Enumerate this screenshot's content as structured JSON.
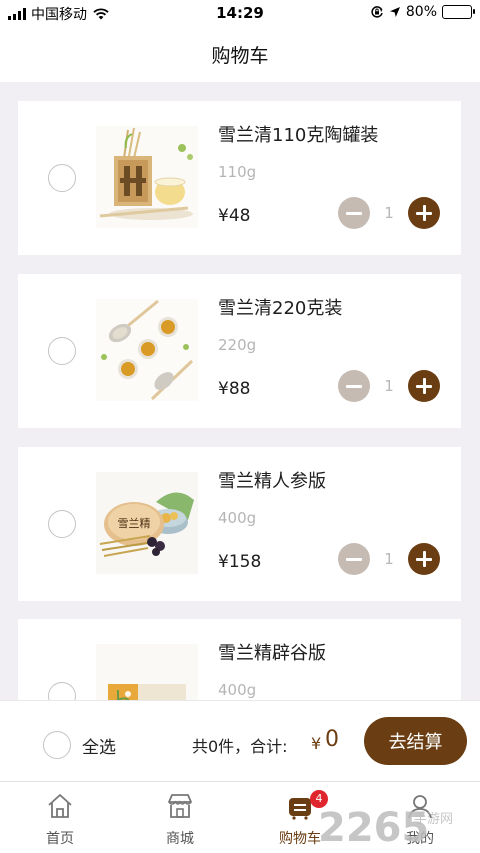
{
  "status_bar": {
    "carrier": "中国移动",
    "time": "14:29",
    "battery_percent": "80%",
    "battery_level": 0.8
  },
  "nav": {
    "title": "购物车"
  },
  "cart": {
    "items": [
      {
        "name": "雪兰清110克陶罐装",
        "spec": "110g",
        "price": "¥48",
        "qty": "1"
      },
      {
        "name": "雪兰清220克装",
        "spec": "220g",
        "price": "¥88",
        "qty": "1"
      },
      {
        "name": "雪兰精人参版",
        "spec": "400g",
        "price": "¥158",
        "qty": "1"
      },
      {
        "name": "雪兰精辟谷版",
        "spec": "400g",
        "price": "",
        "qty": ""
      }
    ],
    "product_label_text": "雪兰精"
  },
  "checkout": {
    "select_all_label": "全选",
    "summary": "共0件，合计:",
    "currency": "¥",
    "total": "0",
    "button_label": "去结算"
  },
  "tabbar": {
    "tabs": [
      {
        "label": "首页",
        "icon": "home-icon"
      },
      {
        "label": "商城",
        "icon": "store-icon"
      },
      {
        "label": "购物车",
        "icon": "cart-icon",
        "badge": "4",
        "active": true
      },
      {
        "label": "我的",
        "icon": "user-icon"
      }
    ]
  },
  "watermark": {
    "text": "2265",
    "subtext": "手游网"
  },
  "colors": {
    "accent": "#6a3d12",
    "minus_button": "#c5bbb3",
    "badge": "#e0262d",
    "background": "#f1eff3"
  }
}
